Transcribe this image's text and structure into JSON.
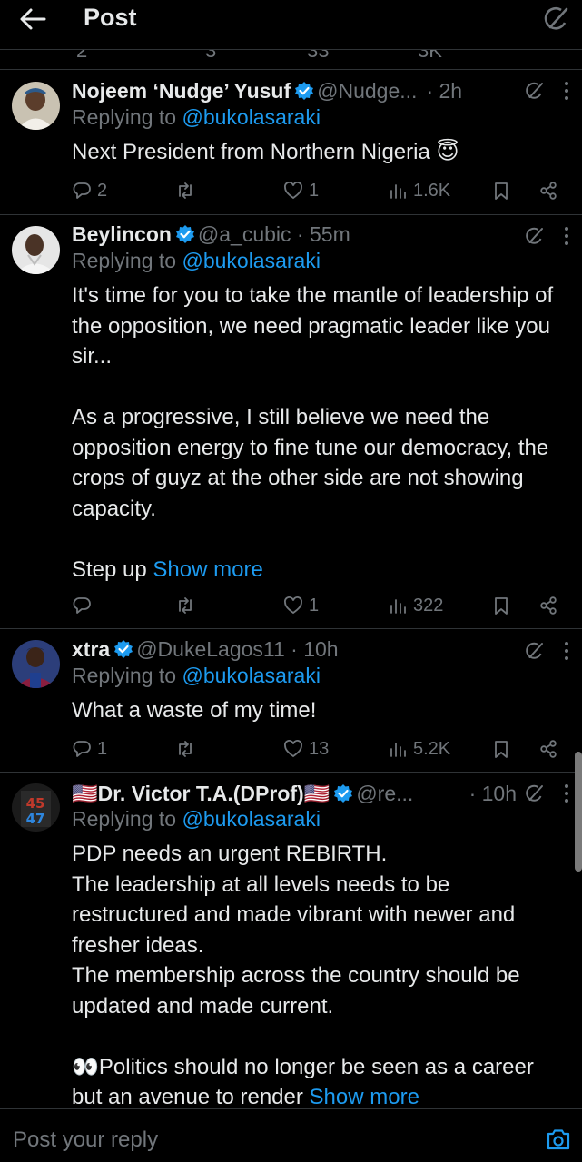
{
  "header": {
    "title": "Post"
  },
  "prev_post_actions": {
    "fragments": [
      "2",
      "3",
      "33",
      "3K"
    ]
  },
  "posts": [
    {
      "name": "Nojeem ‘Nudge’ Yusuf",
      "handle": "@Nudge...",
      "time": "· 2h",
      "replying_prefix": "Replying to ",
      "replying_to": "@bukolasaraki",
      "text": "Next President from Northern Nigeria 😇",
      "show_more": "",
      "replies": "2",
      "reposts": "",
      "likes": "1",
      "views": "1.6K"
    },
    {
      "name": "Beylincon",
      "handle": "@a_cubic · 55m",
      "time": "",
      "replying_prefix": "Replying to ",
      "replying_to": "@bukolasaraki",
      "text": "It's time for you to take the mantle of leadership of the opposition,  we need pragmatic leader like you sir...\n\nAs a progressive, I still believe we need the opposition energy to fine tune  our democracy, the crops of guyz at the other side are not showing capacity.\n\nStep up ",
      "show_more": "Show more",
      "replies": "",
      "reposts": "",
      "likes": "1",
      "views": "322"
    },
    {
      "name": "xtra",
      "handle": "@DukeLagos11 · 10h",
      "time": "",
      "replying_prefix": "Replying to ",
      "replying_to": "@bukolasaraki",
      "text": "What a waste of my time!",
      "show_more": "",
      "replies": "1",
      "reposts": "",
      "likes": "13",
      "views": "5.2K"
    },
    {
      "name": "🇺🇸Dr. Victor T.A.(DProf)🇺🇸",
      "handle": "@re...",
      "time": "· 10h",
      "replying_prefix": "Replying to ",
      "replying_to": "@bukolasaraki",
      "text": "PDP needs an urgent REBIRTH.\nThe leadership at all levels needs to be restructured and made vibrant with newer and fresher ideas.\nThe membership across the country should be updated and made current.\n\n👀Politics should no longer be seen as a career but an avenue to render ",
      "show_more": "Show more"
    }
  ],
  "avatar4_text": [
    "45",
    "47"
  ],
  "reply_bar": {
    "placeholder": "Post your reply"
  },
  "icons": {
    "back": "arrow-left-icon",
    "grok": "grok-icon",
    "verified": "verified-badge-icon",
    "reply": "reply-icon",
    "repost": "repost-icon",
    "like": "heart-icon",
    "views": "views-icon",
    "bookmark": "bookmark-icon",
    "share": "share-icon",
    "camera": "camera-icon",
    "more": "more-icon"
  },
  "colors": {
    "accent": "#1d9bf0",
    "muted": "#71767b",
    "text": "#e7e9ea",
    "background": "#000000",
    "divider": "#2f3336"
  }
}
